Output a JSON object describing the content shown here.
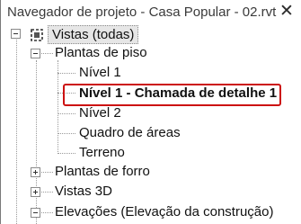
{
  "window": {
    "title": "Navegador de projeto - Casa Popular - 02.rvt",
    "close_glyph": "✕"
  },
  "tree": {
    "root": {
      "label": "Vistas (todas)",
      "icon": "views-icon",
      "expanded": true
    },
    "plantas_de_piso": {
      "label": "Plantas de piso",
      "expanded": true,
      "children": [
        "Nível 1",
        "Nível 1 - Chamada de detalhe 1",
        "Nível 2",
        "Quadro de áreas",
        "Terreno"
      ],
      "highlighted_child": "Nível 1 - Chamada de detalhe 1",
      "highlight_color": "#cc1111"
    },
    "plantas_de_forro": {
      "label": "Plantas de forro",
      "expanded": false
    },
    "vistas_3d": {
      "label": "Vistas 3D",
      "expanded": false
    },
    "elevacoes": {
      "label": "Elevações (Elevação da construção)",
      "expanded": true
    }
  }
}
